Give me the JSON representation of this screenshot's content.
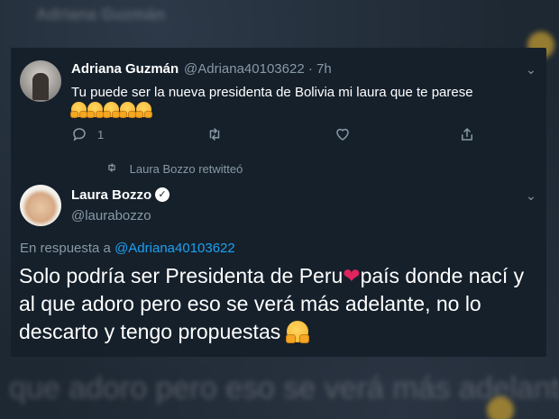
{
  "background": {
    "ghost_top": "Adriana Guzmán",
    "ghost_bottom": "que adoro pero eso se verá más adelante, no lo"
  },
  "tweet1": {
    "author_name": "Adriana Guzmán",
    "handle_time": "@Adriana40103622 · 7h",
    "text": "Tu puede ser la nueva presidenta de Bolivia mi laura que te parese",
    "reply_count": "1",
    "icons": [
      "reply-icon",
      "retweet-icon",
      "like-icon",
      "share-icon",
      "chevron-down-icon"
    ]
  },
  "retweet_notice": {
    "text": "Laura Bozzo retwitteó",
    "icon": "retweet-icon"
  },
  "tweet2": {
    "author_name": "Laura Bozzo",
    "handle": "@laurabozzo",
    "reply_prefix": "En respuesta a",
    "reply_mention": "@Adriana40103622",
    "text_part1": "Solo podría ser Presidenta de Peru",
    "text_part2": "país donde nací y al que adoro pero eso se verá más adelante, no lo descarto y tengo propuestas",
    "verified": true
  },
  "colors": {
    "background": "#15202b",
    "secondary_text": "#8899a6",
    "link": "#1da1f2",
    "heart": "#e0245e"
  }
}
